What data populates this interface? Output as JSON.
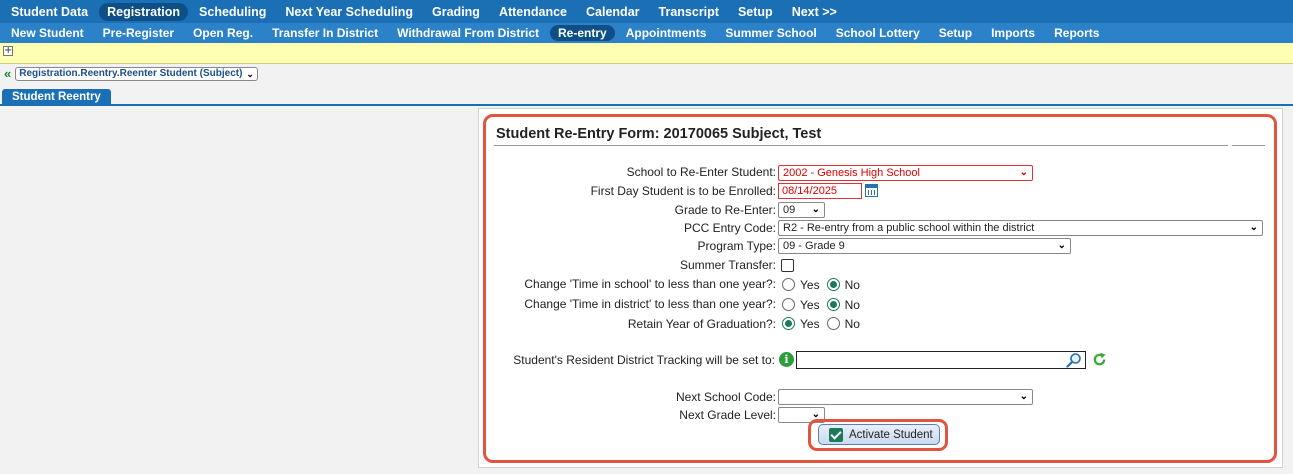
{
  "nav_primary": [
    "Student Data",
    "Registration",
    "Scheduling",
    "Next Year Scheduling",
    "Grading",
    "Attendance",
    "Calendar",
    "Transcript",
    "Setup",
    "Next >>"
  ],
  "nav_primary_active": "Registration",
  "nav_secondary": [
    "New Student",
    "Pre-Register",
    "Open Reg.",
    "Transfer In District",
    "Withdrawal From District",
    "Re-entry",
    "Appointments",
    "Summer School",
    "School Lottery",
    "Setup",
    "Imports",
    "Reports"
  ],
  "nav_secondary_active": "Re-entry",
  "breadcrumb": "Registration.Reentry.Reenter Student (Subject)",
  "tab": "Student Reentry",
  "form": {
    "title": "Student Re-Entry Form: 20170065 Subject, Test",
    "school_label": "School to Re-Enter Student:",
    "school_value": "2002 - Genesis High School",
    "first_day_label": "First Day Student is to be Enrolled:",
    "first_day_value": "08/14/2025",
    "grade_label": "Grade to Re-Enter:",
    "grade_value": "09",
    "pcc_label": "PCC Entry Code:",
    "pcc_value": "R2 - Re-entry from a public school within the district",
    "program_label": "Program Type:",
    "program_value": "09 - Grade 9",
    "summer_label": "Summer Transfer:",
    "time_school_label": "Change 'Time in school' to less than one year?:",
    "time_district_label": "Change 'Time in district' to less than one year?:",
    "retain_label": "Retain Year of Graduation?:",
    "yes": "Yes",
    "no": "No",
    "time_school_value": "No",
    "time_district_value": "No",
    "retain_value": "Yes",
    "tracking_label": "Student's Resident District Tracking will be set to:",
    "tracking_value": "",
    "next_school_label": "Next School Code:",
    "next_school_value": "",
    "next_grade_label": "Next Grade Level:",
    "next_grade_value": "",
    "activate_label": "Activate Student"
  },
  "colors": {
    "nav_primary": "#1a6fb5",
    "nav_secondary": "#2c82c9",
    "highlight": "#e05440",
    "required": "#dd0000"
  }
}
